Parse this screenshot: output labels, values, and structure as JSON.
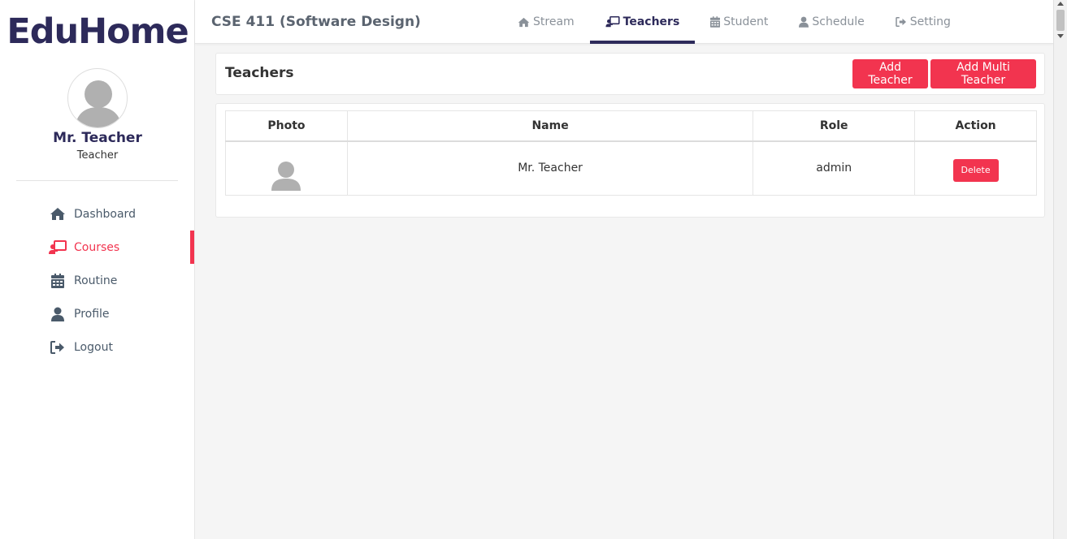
{
  "sidebar": {
    "brand": "EduHome",
    "user": {
      "name": "Mr. Teacher",
      "role": "Teacher"
    },
    "items": [
      {
        "label": "Dashboard",
        "icon": "home-icon",
        "active": false
      },
      {
        "label": "Courses",
        "icon": "chalkboard-teacher-icon",
        "active": true
      },
      {
        "label": "Routine",
        "icon": "calendar-icon",
        "active": false
      },
      {
        "label": "Profile",
        "icon": "user-icon",
        "active": false
      },
      {
        "label": "Logout",
        "icon": "sign-out-icon",
        "active": false
      }
    ]
  },
  "header": {
    "course_title": "CSE 411 (Software Design)",
    "tabs": [
      {
        "label": "Stream",
        "icon": "home-icon",
        "active": false
      },
      {
        "label": "Teachers",
        "icon": "chalkboard-teacher-icon",
        "active": true
      },
      {
        "label": "Student",
        "icon": "calendar-icon",
        "active": false
      },
      {
        "label": "Schedule",
        "icon": "user-icon",
        "active": false
      },
      {
        "label": "Setting",
        "icon": "sign-out-icon",
        "active": false
      }
    ]
  },
  "main": {
    "title": "Teachers",
    "add_teacher_label": "Add Teacher",
    "add_multi_label": "Add Multi Teacher",
    "table": {
      "columns": [
        "Photo",
        "Name",
        "Role",
        "Action"
      ],
      "rows": [
        {
          "name": "Mr. Teacher",
          "role": "admin",
          "action_label": "Delete"
        }
      ]
    }
  },
  "colors": {
    "accent": "#f2344f",
    "brand": "#2d2a5a",
    "nav_text": "#4a5a6a"
  }
}
